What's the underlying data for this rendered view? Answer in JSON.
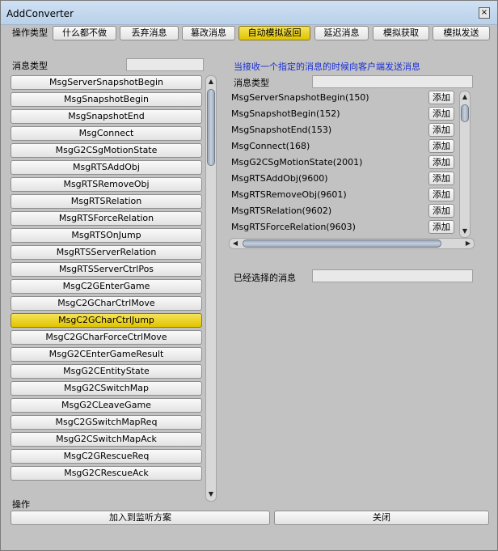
{
  "window": {
    "title": "AddConverter",
    "close_label": "×"
  },
  "op_type": {
    "label": "操作类型",
    "buttons": [
      "什么都不做",
      "丢弃消息",
      "篡改消息",
      "自动模拟返回",
      "延迟消息",
      "模拟获取",
      "模拟发送"
    ],
    "active_index": 3
  },
  "left": {
    "label": "消息类型",
    "filter_value": "",
    "items": [
      "MsgServerSnapshotBegin",
      "MsgSnapshotBegin",
      "MsgSnapshotEnd",
      "MsgConnect",
      "MsgG2CSgMotionState",
      "MsgRTSAddObj",
      "MsgRTSRemoveObj",
      "MsgRTSRelation",
      "MsgRTSForceRelation",
      "MsgRTSOnJump",
      "MsgRTSServerRelation",
      "MsgRTSServerCtrlPos",
      "MsgC2GEnterGame",
      "MsgC2GCharCtrlMove",
      "MsgC2GCharCtrlJump",
      "MsgC2GCharForceCtrlMove",
      "MsgG2CEnterGameResult",
      "MsgG2CEntityState",
      "MsgG2CSwitchMap",
      "MsgG2CLeaveGame",
      "MsgC2GSwitchMapReq",
      "MsgG2CSwitchMapAck",
      "MsgC2GRescueReq",
      "MsgG2CRescueAck"
    ],
    "selected_index": 14
  },
  "right": {
    "hint": "当接收一个指定的消息的时候向客户端发送消息",
    "hint_color": "#1a2fd6",
    "type_label": "消息类型",
    "type_value": "",
    "add_label": "添加",
    "items": [
      "MsgServerSnapshotBegin(150)",
      "MsgSnapshotBegin(152)",
      "MsgSnapshotEnd(153)",
      "MsgConnect(168)",
      "MsgG2CSgMotionState(2001)",
      "MsgRTSAddObj(9600)",
      "MsgRTSRemoveObj(9601)",
      "MsgRTSRelation(9602)",
      "MsgRTSForceRelation(9603)"
    ],
    "selected_label": "已经选择的消息",
    "selected_value": ""
  },
  "footer": {
    "label": "操作",
    "add_to_plan": "加入到监听方案",
    "close": "关闭"
  }
}
